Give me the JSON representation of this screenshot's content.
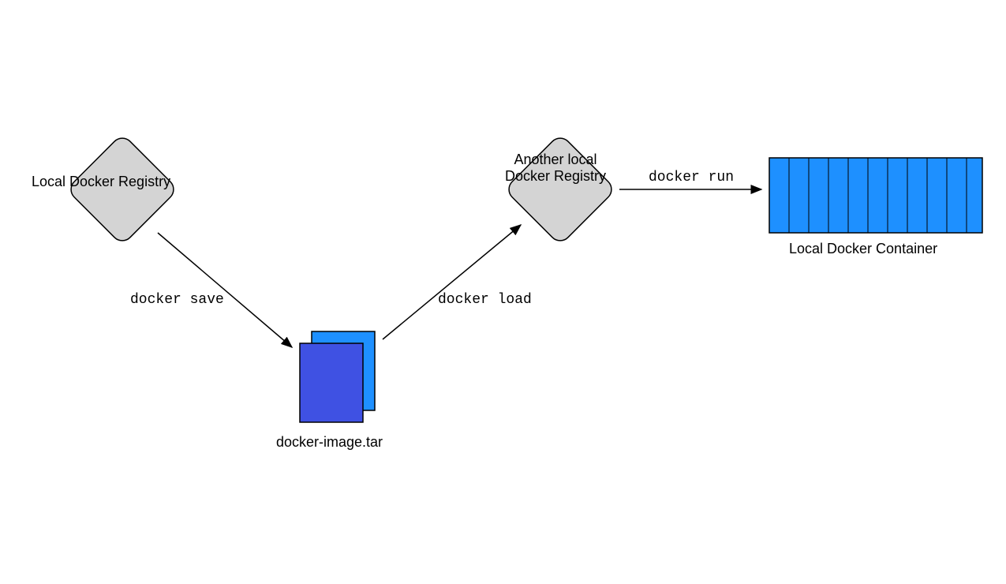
{
  "nodes": {
    "local_registry": {
      "label": "Local Docker Registry"
    },
    "another_registry": {
      "label_line1": "Another local",
      "label_line2": "Docker Registry"
    },
    "tar_file": {
      "label": "docker-image.tar"
    },
    "container": {
      "label": "Local Docker Container"
    }
  },
  "edges": {
    "save": {
      "label": "docker save"
    },
    "load": {
      "label": "docker load"
    },
    "run": {
      "label": "docker run"
    }
  },
  "colors": {
    "diamond_fill": "#d4d4d4",
    "file_back": "#1e90ff",
    "file_front": "#3f51e3",
    "container_fill": "#1e90ff",
    "stroke": "#000000"
  }
}
